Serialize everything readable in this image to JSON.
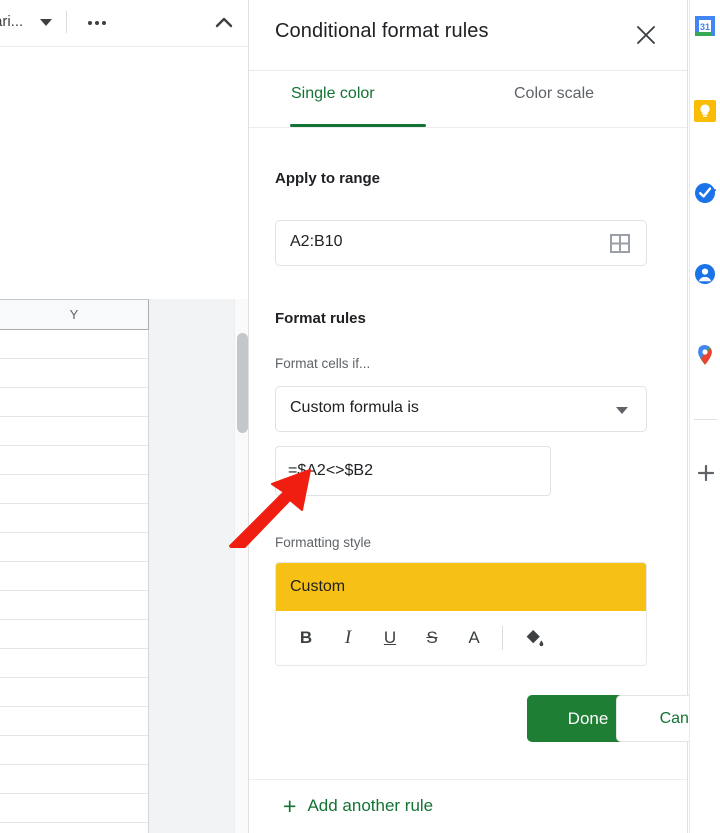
{
  "spreadsheet": {
    "toolbar": {
      "font_name": "ari...",
      "font_caret_icon": "caret-down-icon",
      "more_icon": "more-horizontal-icon",
      "collapse_icon": "chevron-up-icon"
    },
    "grid": {
      "column_header": "Y",
      "row_count": 17
    },
    "scrollbar": "vertical-scrollbar"
  },
  "panel": {
    "title": "Conditional format rules",
    "close_icon": "close-icon",
    "tabs": [
      {
        "label": "Single color",
        "active": true
      },
      {
        "label": "Color scale",
        "active": false
      }
    ],
    "apply_to_range": {
      "label": "Apply to range",
      "value": "A2:B10",
      "picker_icon": "grid-select-icon"
    },
    "format_rules": {
      "label": "Format rules",
      "condition_label": "Format cells if...",
      "condition_value": "Custom formula is",
      "condition_caret_icon": "caret-down-icon",
      "formula_value": "=$A2<>$B2"
    },
    "formatting_style": {
      "label": "Formatting style",
      "preview_text": "Custom",
      "preview_bg": "#F6C014",
      "preview_fg": "#202124",
      "tools": [
        {
          "name": "bold-icon",
          "glyph": "B"
        },
        {
          "name": "italic-icon",
          "glyph": "I"
        },
        {
          "name": "underline-icon",
          "glyph": "U"
        },
        {
          "name": "strikethrough-icon",
          "glyph": "S"
        },
        {
          "name": "text-color-icon",
          "glyph": "A"
        },
        {
          "name": "fill-color-icon",
          "glyph": "fill"
        }
      ]
    },
    "buttons": {
      "cancel": "Cancel",
      "done": "Done",
      "add_another_rule": "Add another rule",
      "add_icon": "plus-icon"
    },
    "accent_green": "#137333",
    "done_green": "#1E7E34"
  },
  "annotation": {
    "arrow": "red-arrow-pointing-to-formula-field",
    "color": "#F01E10"
  },
  "side_rail": {
    "items": [
      {
        "name": "google-calendar-icon",
        "label": "31"
      },
      {
        "name": "google-keep-icon",
        "label": ""
      },
      {
        "name": "google-tasks-icon",
        "label": ""
      },
      {
        "name": "google-contacts-icon",
        "label": ""
      },
      {
        "name": "google-maps-icon",
        "label": ""
      }
    ],
    "add_icon": "plus-icon"
  }
}
